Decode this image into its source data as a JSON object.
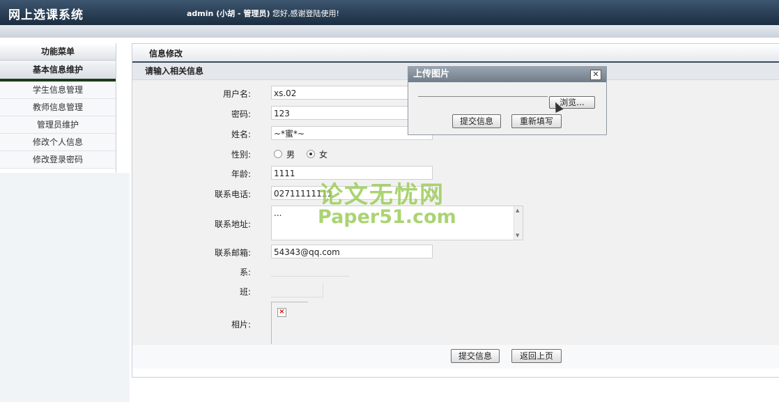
{
  "header": {
    "app_title": "网上选课系统",
    "user": "admin (小胡 - 管理员)",
    "greeting": "您好,感谢登陆使用!"
  },
  "sidebar": {
    "menu_title": "功能菜单",
    "group_label": "基本信息维护",
    "items": [
      {
        "label": "学生信息管理"
      },
      {
        "label": "教师信息管理"
      },
      {
        "label": "管理员维护"
      },
      {
        "label": "修改个人信息"
      },
      {
        "label": "修改登录密码"
      }
    ]
  },
  "panel": {
    "title": "信息修改",
    "subtitle": "请输入相关信息"
  },
  "form": {
    "username_label": "用户名:",
    "username_value": "xs.02",
    "password_label": "密码:",
    "password_value": "123",
    "name_label": "姓名:",
    "name_value": "~*蜜*~",
    "gender_label": "性别:",
    "gender_male": "男",
    "gender_female": "女",
    "gender_selected": "女",
    "age_label": "年龄:",
    "age_value": "1111",
    "phone_label": "联系电话:",
    "phone_value": "02711111111",
    "address_label": "联系地址:",
    "address_value": "...",
    "email_label": "联系邮箱:",
    "email_value": "54343@qq.com",
    "dept_label": "系:",
    "class_label": "班:",
    "photo_label": "相片:"
  },
  "buttons": {
    "submit": "提交信息",
    "back": "返回上页"
  },
  "upload_dialog": {
    "title": "上传图片",
    "browse": "浏览...",
    "submit": "提交信息",
    "reset": "重新填写",
    "close_glyph": "✕"
  },
  "watermark": {
    "line1": "论文无忧网",
    "line2": "Paper51.com"
  }
}
